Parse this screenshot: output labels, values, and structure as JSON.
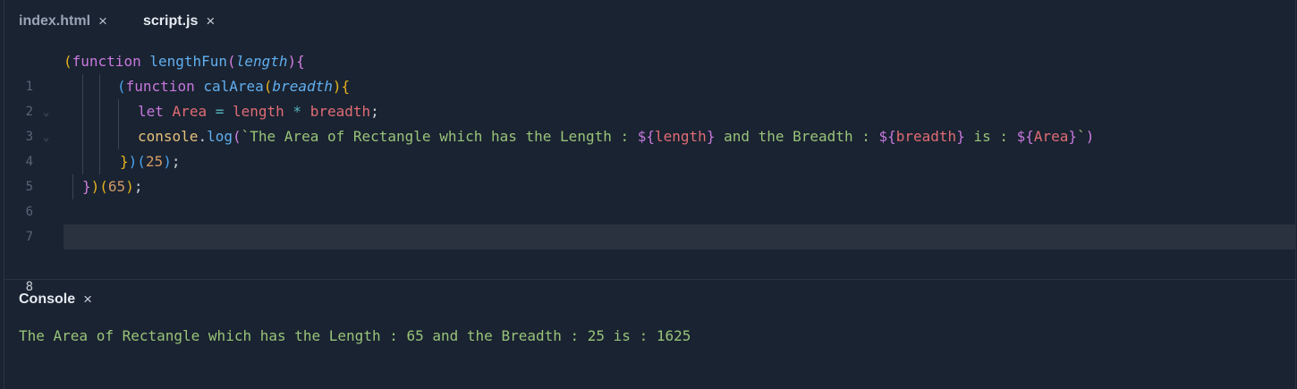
{
  "tabs": [
    {
      "label": "index.html",
      "close": "×",
      "active": false
    },
    {
      "label": "script.js",
      "close": "×",
      "active": true
    }
  ],
  "line_numbers": [
    "1",
    "2",
    "3",
    "4",
    "5",
    "6",
    "7",
    "8"
  ],
  "fold_marker": "⌄",
  "current_line": 8,
  "code": {
    "l1": {
      "open_paren": "(",
      "function_kw": "function",
      "fn_name": "lengthFun",
      "paren_open": "(",
      "param": "length",
      "paren_close": ")",
      "brace": "{"
    },
    "l2": {
      "open_paren": "(",
      "function_kw": "function",
      "fn_name": "calArea",
      "paren_open": "(",
      "param": "breadth",
      "paren_close": ")",
      "brace": "{"
    },
    "l3": {
      "let_kw": "let",
      "var": "Area",
      "assign": " = ",
      "ident1": "length",
      "mult": " * ",
      "ident2": "breadth",
      "semi": ";"
    },
    "l4": {
      "obj": "console",
      "dot": ".",
      "method": "log",
      "paren_open": "(",
      "backtick_open": "`",
      "str1": "The Area of Rectangle which has the Length : ",
      "tpl1_open": "${",
      "tpl1_var": "length",
      "tpl1_close": "}",
      "str2": " and the Breadth : ",
      "tpl2_open": "${",
      "tpl2_var": "breadth",
      "tpl2_close": "}",
      "str3": " is : ",
      "tpl3_open": "${",
      "tpl3_var": "Area",
      "tpl3_close": "}",
      "backtick_close": "`",
      "paren_close": ")"
    },
    "l5": {
      "brace": "}",
      "paren_close": ")",
      "arg_open": "(",
      "arg": "25",
      "arg_close": ")",
      "semi": ";"
    },
    "l6": {
      "brace": "}",
      "paren_close": ")",
      "arg_open": "(",
      "arg": "65",
      "arg_close": ")",
      "semi": ";"
    }
  },
  "console": {
    "label": "Console",
    "close": "×",
    "output": "The Area of Rectangle which has the Length : 65 and the Breadth : 25 is : 1625"
  },
  "colors": {
    "background": "#1a2331",
    "current_line": "#2a3240",
    "string": "#98c379",
    "keyword": "#c678dd",
    "function": "#61afef",
    "identifier": "#e06c75",
    "number": "#d19a66"
  }
}
